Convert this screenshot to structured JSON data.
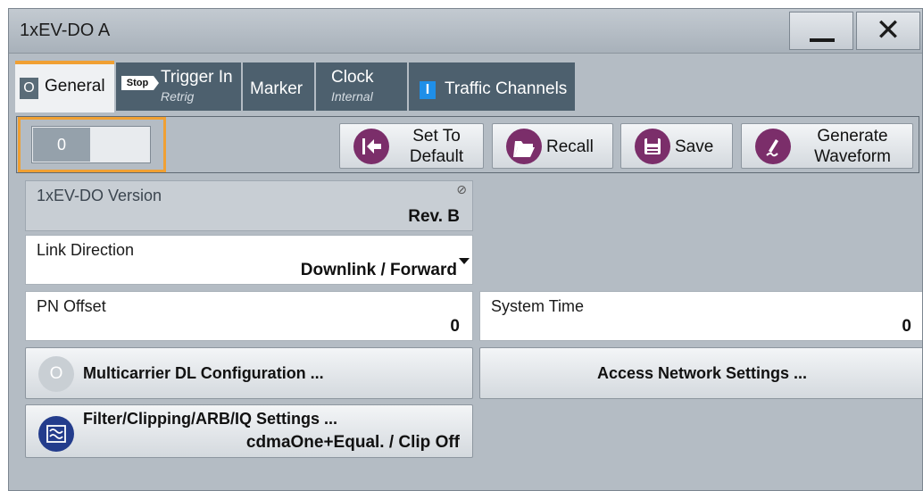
{
  "window": {
    "title": "1xEV-DO A",
    "minimize_icon": "minimize-icon",
    "close_icon": "close-icon",
    "close_glyph": "✕"
  },
  "tabs": [
    {
      "label": "General",
      "state": "O",
      "active": true
    },
    {
      "label": "Trigger In",
      "badge": "Stop",
      "sub": "Retrig"
    },
    {
      "label": "Marker"
    },
    {
      "label": "Clock",
      "sub": "Internal"
    },
    {
      "label": "Traffic Channels",
      "badge": "I"
    }
  ],
  "toolbar": {
    "state_toggle": {
      "value": "0"
    },
    "set_to_default": {
      "line1": "Set To",
      "line2": "Default"
    },
    "recall": "Recall",
    "save": "Save",
    "generate_waveform": {
      "line1": "Generate",
      "line2": "Waveform"
    }
  },
  "settings": {
    "version": {
      "label": "1xEV-DO Version",
      "value": "Rev. B"
    },
    "link_direction": {
      "label": "Link Direction",
      "value": "Downlink / Forward"
    },
    "pn_offset": {
      "label": "PN Offset",
      "value": "0"
    },
    "system_time": {
      "label": "System Time",
      "value": "0"
    },
    "multicarrier": {
      "label": "Multicarrier DL Configuration ...",
      "state": "O"
    },
    "access_network": {
      "label": "Access Network Settings ..."
    },
    "filter": {
      "label": "Filter/Clipping/ARB/IQ Settings ...",
      "value": "cdmaOne+Equal. / Clip Off"
    }
  },
  "colors": {
    "accent": "#f0a033",
    "icon_purple": "#7b2e6a",
    "tab_dark": "#4d606e",
    "filter_icon": "#233c8c"
  }
}
